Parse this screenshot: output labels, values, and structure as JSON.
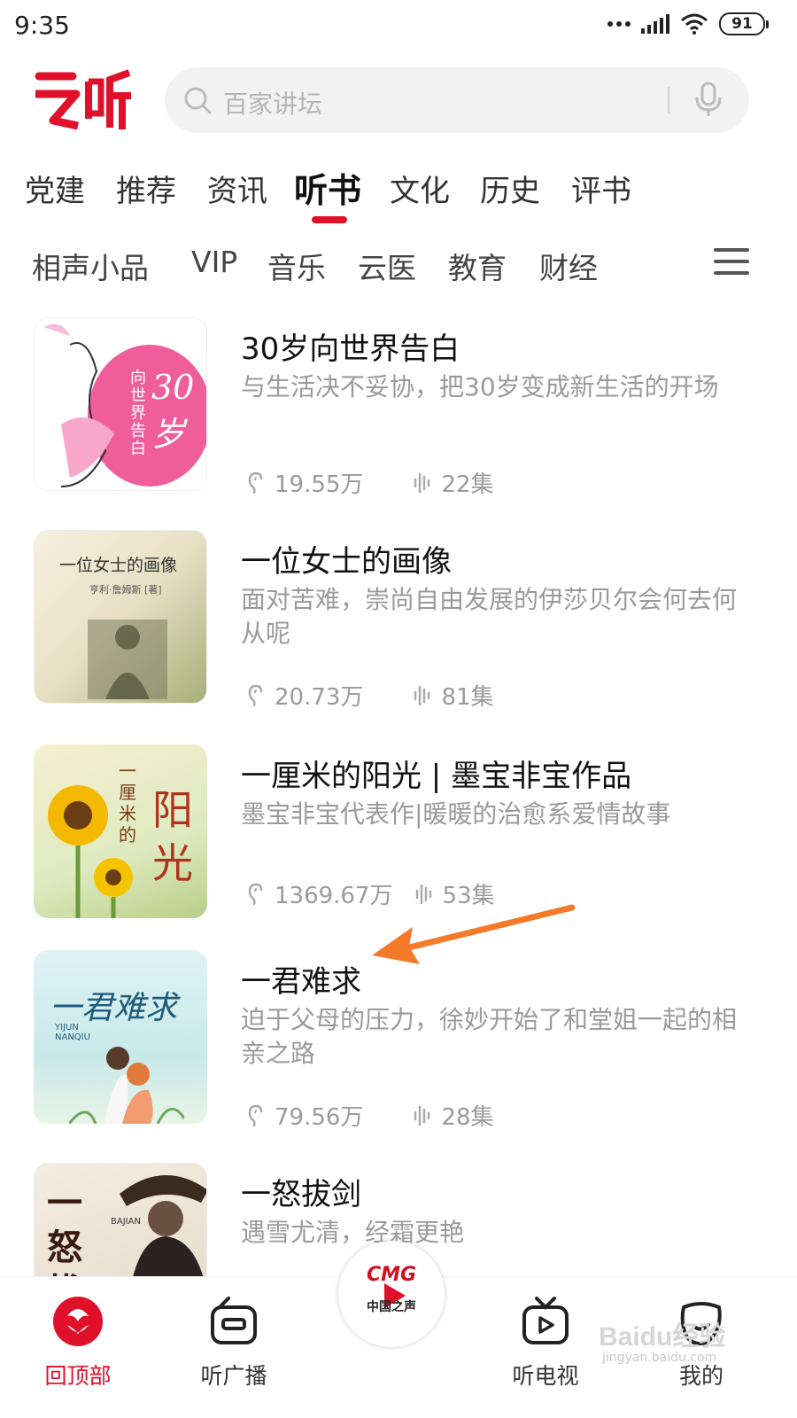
{
  "status_bar": {
    "time": "9:35",
    "battery": "91"
  },
  "search": {
    "placeholder": "百家讲坛"
  },
  "tabs": [
    {
      "label": "党建"
    },
    {
      "label": "推荐"
    },
    {
      "label": "资讯"
    },
    {
      "label": "听书",
      "active": true
    },
    {
      "label": "文化"
    },
    {
      "label": "历史"
    },
    {
      "label": "评书"
    }
  ],
  "subtabs": [
    {
      "label": "相声小品"
    },
    {
      "label": "VIP"
    },
    {
      "label": "音乐"
    },
    {
      "label": "云医"
    },
    {
      "label": "教育"
    },
    {
      "label": "财经"
    }
  ],
  "books": [
    {
      "title": "30岁向世界告白",
      "desc": "与生活决不妥协，把30岁变成新生活的开场",
      "plays": "19.55万",
      "episodes": "22集",
      "cover_text": "30岁",
      "cover_sub": "向世界告白"
    },
    {
      "title": "一位女士的画像",
      "desc": "面对苦难，崇尚自由发展的伊莎贝尔会何去何从呢",
      "plays": "20.73万",
      "episodes": "81集",
      "cover_text": "一位女士的画像",
      "cover_sub": "亨利·詹姆斯 [著]"
    },
    {
      "title": "一厘米的阳光 | 墨宝非宝作品",
      "desc": "墨宝非宝代表作|暖暖的治愈系爱情故事",
      "plays": "1369.67万",
      "episodes": "53集",
      "cover_text": "阳光",
      "cover_sub": "一厘米的"
    },
    {
      "title": "一君难求",
      "desc": "迫于父母的压力，徐妙开始了和堂姐一起的相亲之路",
      "plays": "79.56万",
      "episodes": "28集",
      "cover_text": "一君难求",
      "cover_sub": "YIJUN NANQIU"
    },
    {
      "title": "一怒拔剑",
      "desc": "遇雪尤清，经霜更艳",
      "cover_text": "一怒拔",
      "cover_sub": "BAJIAN"
    }
  ],
  "bottom_nav": [
    {
      "label": "回顶部",
      "icon": "top-icon",
      "active": true
    },
    {
      "label": "听广播",
      "icon": "radio-icon"
    },
    {
      "label": "听电视",
      "icon": "tv-icon"
    },
    {
      "label": "我的",
      "icon": "profile-icon"
    }
  ],
  "player": {
    "brand": "CMG",
    "station": "中国之声"
  },
  "watermark": {
    "brand": "Baidu经验",
    "url": "jingyan.baidu.com"
  },
  "colors": {
    "accent": "#e0102a",
    "arrow": "#f47a2a",
    "text_secondary": "#9a9a9a"
  }
}
